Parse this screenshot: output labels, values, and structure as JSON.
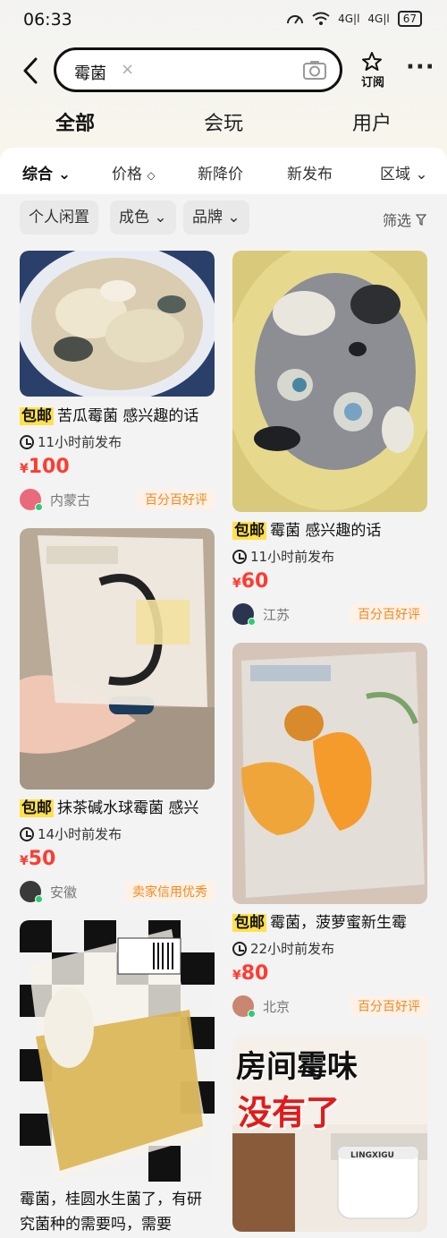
{
  "status_bar": {
    "time": "06:33",
    "network": "4G|l",
    "network2": "4G|l",
    "battery": "67"
  },
  "search": {
    "keyword": "霉菌",
    "clear_icon": "×"
  },
  "header": {
    "subscribe_label": "订阅"
  },
  "tabs": [
    {
      "label": "全部",
      "active": true
    },
    {
      "label": "会玩"
    },
    {
      "label": "用户"
    }
  ],
  "sort_bar": [
    {
      "label": "综合",
      "suffix": "⌄"
    },
    {
      "label": "价格",
      "suffix": "◇"
    },
    {
      "label": "新降价"
    },
    {
      "label": "新发布"
    },
    {
      "label": "区域",
      "suffix": "⌄"
    }
  ],
  "chips": [
    {
      "label": "个人闲置"
    },
    {
      "label": "成色 ⌄"
    },
    {
      "label": "品牌 ⌄"
    }
  ],
  "filter_label": "筛选",
  "accent_color": "#ffe14a",
  "price_color": "#ff3b30",
  "products": [
    {
      "tag": "包邮",
      "title": "苦瓜霉菌 感兴趣的话",
      "time": "11小时前发布",
      "price_symbol": "¥",
      "price": "100",
      "location": "内蒙古",
      "badge": "百分百好评"
    },
    {
      "tag": "包邮",
      "title": "霉菌 感兴趣的话",
      "time": "11小时前发布",
      "price_symbol": "¥",
      "price": "60",
      "location": "江苏",
      "badge": "百分百好评"
    },
    {
      "tag": "包邮",
      "title": "抹茶碱水球霉菌 感兴",
      "time": "14小时前发布",
      "price_symbol": "¥",
      "price": "50",
      "location": "安徽",
      "badge": "卖家信用优秀"
    },
    {
      "tag": "包邮",
      "title": "霉菌，菠萝蜜新生霉",
      "time": "22小时前发布",
      "price_symbol": "¥",
      "price": "80",
      "location": "北京",
      "badge": "百分百好评"
    },
    {
      "description": "霉菌，桂圆水生菌了，有研究菌种的需要吗，需要"
    }
  ],
  "ad": {
    "line1": "房间霉味",
    "line2": "没有了",
    "brand": "LINGXIGU"
  }
}
